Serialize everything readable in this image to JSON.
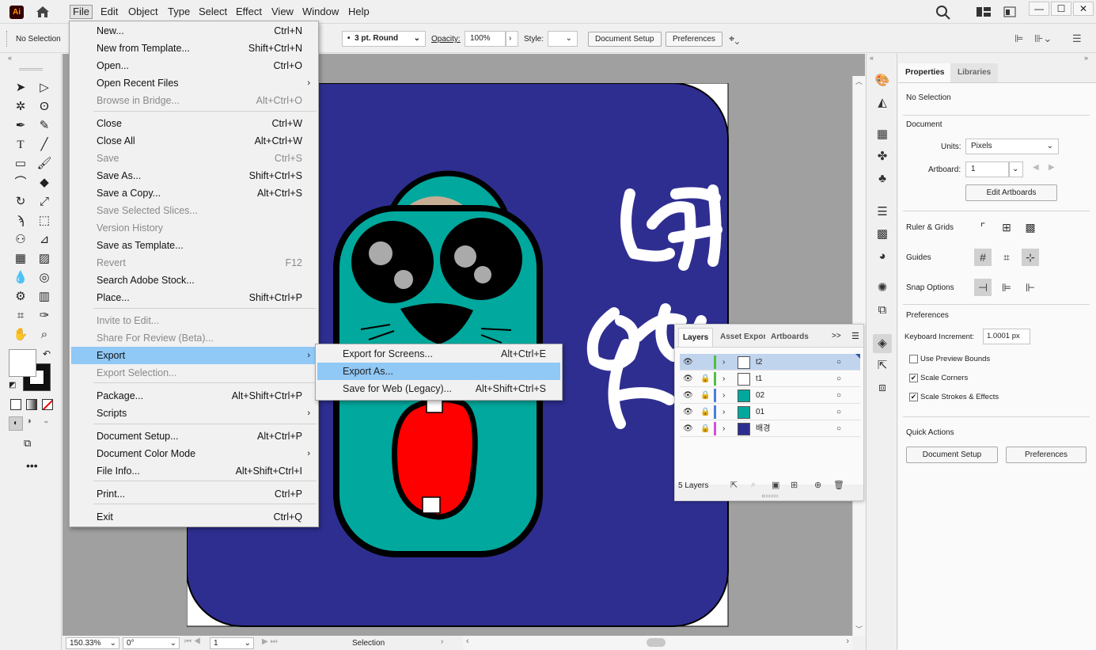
{
  "app": {
    "logo_text": "Ai"
  },
  "menubar": {
    "items": [
      "File",
      "Edit",
      "Object",
      "Type",
      "Select",
      "Effect",
      "View",
      "Window",
      "Help"
    ]
  },
  "window_controls": {
    "minimize": "—",
    "maximize": "☐",
    "close": "✕"
  },
  "control_bar": {
    "selection_label": "No Selection",
    "stroke_profile": "3 pt. Round",
    "opacity_label": "Opacity:",
    "opacity_value": "100%",
    "style_label": "Style:",
    "document_setup": "Document Setup",
    "preferences": "Preferences"
  },
  "file_menu": {
    "items": [
      {
        "label": "New...",
        "shortcut": "Ctrl+N"
      },
      {
        "label": "New from Template...",
        "shortcut": "Shift+Ctrl+N"
      },
      {
        "label": "Open...",
        "shortcut": "Ctrl+O"
      },
      {
        "label": "Open Recent Files",
        "shortcut": ""
      },
      {
        "label": "Browse in Bridge...",
        "shortcut": "Alt+Ctrl+O"
      },
      {
        "label": "Close",
        "shortcut": "Ctrl+W"
      },
      {
        "label": "Close All",
        "shortcut": "Alt+Ctrl+W"
      },
      {
        "label": "Save",
        "shortcut": "Ctrl+S"
      },
      {
        "label": "Save As...",
        "shortcut": "Shift+Ctrl+S"
      },
      {
        "label": "Save a Copy...",
        "shortcut": "Alt+Ctrl+S"
      },
      {
        "label": "Save Selected Slices...",
        "shortcut": ""
      },
      {
        "label": "Version History",
        "shortcut": ""
      },
      {
        "label": "Save as Template...",
        "shortcut": ""
      },
      {
        "label": "Revert",
        "shortcut": "F12"
      },
      {
        "label": "Search Adobe Stock...",
        "shortcut": ""
      },
      {
        "label": "Place...",
        "shortcut": "Shift+Ctrl+P"
      },
      {
        "label": "Invite to Edit...",
        "shortcut": ""
      },
      {
        "label": "Share For Review (Beta)...",
        "shortcut": ""
      },
      {
        "label": "Export",
        "shortcut": ""
      },
      {
        "label": "Export Selection...",
        "shortcut": ""
      },
      {
        "label": "Package...",
        "shortcut": "Alt+Shift+Ctrl+P"
      },
      {
        "label": "Scripts",
        "shortcut": ""
      },
      {
        "label": "Document Setup...",
        "shortcut": "Alt+Ctrl+P"
      },
      {
        "label": "Document Color Mode",
        "shortcut": ""
      },
      {
        "label": "File Info...",
        "shortcut": "Alt+Shift+Ctrl+I"
      },
      {
        "label": "Print...",
        "shortcut": "Ctrl+P"
      },
      {
        "label": "Exit",
        "shortcut": "Ctrl+Q"
      }
    ]
  },
  "export_submenu": {
    "items": [
      {
        "label": "Export for Screens...",
        "shortcut": "Alt+Ctrl+E"
      },
      {
        "label": "Export As...",
        "shortcut": ""
      },
      {
        "label": "Save for Web (Legacy)...",
        "shortcut": "Alt+Shift+Ctrl+S"
      }
    ]
  },
  "status_bar": {
    "zoom": "150.33%",
    "rotation": "0°",
    "artboard": "1",
    "tool": "Selection"
  },
  "properties_panel": {
    "tabs": [
      "Properties",
      "Libraries"
    ],
    "selection": "No Selection",
    "document_heading": "Document",
    "units_label": "Units:",
    "units_value": "Pixels",
    "artboard_label": "Artboard:",
    "artboard_value": "1",
    "edit_artboards": "Edit Artboards",
    "ruler_grids": "Ruler & Grids",
    "guides": "Guides",
    "snap_options": "Snap Options",
    "preferences_heading": "Preferences",
    "keyboard_increment_label": "Keyboard Increment:",
    "keyboard_increment_value": "1.0001 px",
    "use_preview_bounds": "Use Preview Bounds",
    "scale_corners": "Scale Corners",
    "scale_strokes": "Scale Strokes & Effects",
    "quick_actions": "Quick Actions",
    "document_setup_btn": "Document Setup",
    "preferences_btn": "Preferences"
  },
  "layers_panel": {
    "tabs": [
      "Layers",
      "Asset Expor",
      "Artboards"
    ],
    "layers": [
      {
        "name": "t2",
        "color": "#4fbf3f",
        "selected": true,
        "locked": false
      },
      {
        "name": "t1",
        "color": "#4fbf3f",
        "selected": false,
        "locked": true
      },
      {
        "name": "02",
        "color": "#4a7fd8",
        "selected": false,
        "locked": true
      },
      {
        "name": "01",
        "color": "#4a7fd8",
        "selected": false,
        "locked": true
      },
      {
        "name": "배경",
        "color": "#d84fd8",
        "selected": false,
        "locked": true
      }
    ],
    "count": "5 Layers"
  },
  "colors": {
    "artboard_bg": "#2e2e91",
    "character_teal": "#00a89d",
    "mouth_red": "#ff0000",
    "ear_inner": "#c8ad95",
    "menu_highlight": "#90c8f6"
  }
}
